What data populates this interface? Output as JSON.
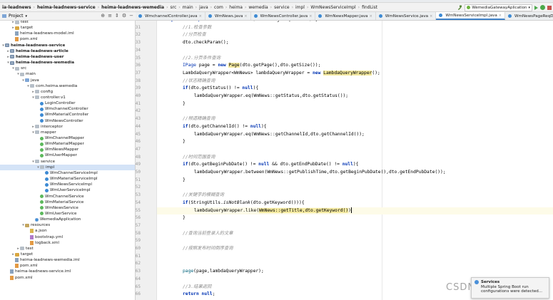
{
  "breadcrumbs": [
    "ia-leadnews",
    "heima-leadnews-service",
    "heima-leadnews-wemedia",
    "src",
    "main",
    "java",
    "com",
    "heima",
    "wemedia",
    "service",
    "impl",
    "WmNewsServiceImpl",
    "findList"
  ],
  "toolbar": {
    "run_config": "WemediaGatewayAplication"
  },
  "project": {
    "title": "Project"
  },
  "tree": [
    {
      "label": "test",
      "indent": 2,
      "icon": "folder",
      "arrow": ">"
    },
    {
      "label": "target",
      "indent": 2,
      "icon": "target",
      "arrow": ">"
    },
    {
      "label": "heima-leadnews-model.iml",
      "indent": 2,
      "icon": "iml",
      "arrow": ""
    },
    {
      "label": "pom.xml",
      "indent": 2,
      "icon": "xml",
      "arrow": ""
    },
    {
      "label": "heima-leadnews-service",
      "indent": 0,
      "icon": "mod",
      "arrow": "v",
      "bold": true
    },
    {
      "label": "heima-leadnews-article",
      "indent": 1,
      "icon": "mod",
      "arrow": ">",
      "bold": true
    },
    {
      "label": "heima-leadnews-user",
      "indent": 1,
      "icon": "mod",
      "arrow": ">",
      "bold": true
    },
    {
      "label": "heima-leadnews-wemedia",
      "indent": 1,
      "icon": "mod",
      "arrow": "v",
      "bold": true
    },
    {
      "label": "src",
      "indent": 2,
      "icon": "folder",
      "arrow": "v"
    },
    {
      "label": "main",
      "indent": 3,
      "icon": "folder",
      "arrow": "v"
    },
    {
      "label": "java",
      "indent": 4,
      "icon": "src",
      "arrow": "v"
    },
    {
      "label": "com.heima.wemedia",
      "indent": 5,
      "icon": "folder",
      "arrow": "v"
    },
    {
      "label": "config",
      "indent": 6,
      "icon": "folder",
      "arrow": ">"
    },
    {
      "label": "controller.v1",
      "indent": 6,
      "icon": "folder",
      "arrow": "v"
    },
    {
      "label": "LoginController",
      "indent": 7,
      "icon": "cls",
      "arrow": ""
    },
    {
      "label": "WmchannelController",
      "indent": 7,
      "icon": "cls",
      "arrow": ""
    },
    {
      "label": "WmMaterialController",
      "indent": 7,
      "icon": "cls",
      "arrow": ""
    },
    {
      "label": "WmNewsController",
      "indent": 7,
      "icon": "cls",
      "arrow": ""
    },
    {
      "label": "interceptor",
      "indent": 6,
      "icon": "folder",
      "arrow": ">"
    },
    {
      "label": "mapper",
      "indent": 6,
      "icon": "folder",
      "arrow": "v"
    },
    {
      "label": "WmChannelMapper",
      "indent": 7,
      "icon": "ifc",
      "arrow": ""
    },
    {
      "label": "WmMaterialMapper",
      "indent": 7,
      "icon": "ifc",
      "arrow": ""
    },
    {
      "label": "WmNewsMapper",
      "indent": 7,
      "icon": "ifc",
      "arrow": ""
    },
    {
      "label": "WmUserMapper",
      "indent": 7,
      "icon": "ifc",
      "arrow": ""
    },
    {
      "label": "service",
      "indent": 6,
      "icon": "folder",
      "arrow": "v"
    },
    {
      "label": "impl",
      "indent": 7,
      "icon": "folder",
      "arrow": "v",
      "selected": true
    },
    {
      "label": "WmChannelServiceImpl",
      "indent": 8,
      "icon": "cls",
      "arrow": ""
    },
    {
      "label": "WmMaterialServiceImpl",
      "indent": 8,
      "icon": "cls",
      "arrow": ""
    },
    {
      "label": "WmNewsServiceImpl",
      "indent": 8,
      "icon": "cls",
      "arrow": ""
    },
    {
      "label": "WmUserServiceImpl",
      "indent": 8,
      "icon": "cls",
      "arrow": ""
    },
    {
      "label": "WmChannelService",
      "indent": 7,
      "icon": "ifc",
      "arrow": ""
    },
    {
      "label": "WmMaterialService",
      "indent": 7,
      "icon": "ifc",
      "arrow": ""
    },
    {
      "label": "WmNewsService",
      "indent": 7,
      "icon": "ifc",
      "arrow": ""
    },
    {
      "label": "WmUserService",
      "indent": 7,
      "icon": "ifc",
      "arrow": ""
    },
    {
      "label": "WemediaApplication",
      "indent": 6,
      "icon": "app",
      "arrow": ""
    },
    {
      "label": "resources",
      "indent": 4,
      "icon": "res",
      "arrow": "v"
    },
    {
      "label": "a.json",
      "indent": 5,
      "icon": "json",
      "arrow": ""
    },
    {
      "label": "bootstrap.yml",
      "indent": 5,
      "icon": "yml",
      "arrow": ""
    },
    {
      "label": "logback.xml",
      "indent": 5,
      "icon": "xml",
      "arrow": ""
    },
    {
      "label": "test",
      "indent": 3,
      "icon": "folder",
      "arrow": ">"
    },
    {
      "label": "target",
      "indent": 2,
      "icon": "target",
      "arrow": ">"
    },
    {
      "label": "heima-leadnews-wemedia.iml",
      "indent": 2,
      "icon": "iml",
      "arrow": ""
    },
    {
      "label": "pom.xml",
      "indent": 2,
      "icon": "xml",
      "arrow": ""
    },
    {
      "label": "heima-leadnews-service.iml",
      "indent": 1,
      "icon": "iml",
      "arrow": ""
    },
    {
      "label": "pom.xml",
      "indent": 1,
      "icon": "xml",
      "arrow": ""
    }
  ],
  "tabs": [
    {
      "label": "WmchannelController.java",
      "active": false
    },
    {
      "label": "WmNews.java",
      "active": false
    },
    {
      "label": "WmNewsController.java",
      "active": false
    },
    {
      "label": "WmNewsMapper.java",
      "active": false
    },
    {
      "label": "WmNewsService.java",
      "active": false
    },
    {
      "label": "WmNewsServiceImpl.java",
      "active": true
    },
    {
      "label": "WmNewsPageReqDto.java",
      "active": false
    }
  ],
  "editor": {
    "lines": [
      {
        "n": "30",
        "html": "<span class='kw'>public</span> <span class='typ'>ResponseResult</span> <span class='meth'>findList</span>(WmNewsPageReqDto dto) {",
        "indent": 0
      },
      {
        "n": "31",
        "html": "<span class='cm'>//1.检查参数</span>",
        "indent": 1
      },
      {
        "n": "32",
        "html": "<span class='cm'>//分页检查</span>",
        "indent": 1
      },
      {
        "n": "33",
        "html": "dto.checkParam();",
        "indent": 1
      },
      {
        "n": "34",
        "html": "",
        "indent": 1
      },
      {
        "n": "35",
        "html": "<span class='cm'>//2.分页条件查询</span>",
        "indent": 1
      },
      {
        "n": "36",
        "html": "<span class='typ'>IPage</span> page = <span class='kw'>new</span> <span class='hlw'>Page</span>(dto.getPage(),dto.getSize());",
        "indent": 1
      },
      {
        "n": "37",
        "html": "LambdaQueryWrapper&lt;WmNews&gt; lambdaQueryWrapper = <span class='kw'>new</span> <span class='hlw'>LambdaQueryWrapper</span>();",
        "indent": 1
      },
      {
        "n": "38",
        "html": "<span class='cm'>//状态精确查询</span>",
        "indent": 1
      },
      {
        "n": "39",
        "html": "<span class='kw'>if</span>(dto.getStatus() != <span class='kw'>null</span>){",
        "indent": 1
      },
      {
        "n": "40",
        "html": "lambdaQueryWrapper.eq(WmNews::getStatus,dto.getStatus());",
        "indent": 2
      },
      {
        "n": "41",
        "html": "}",
        "indent": 1
      },
      {
        "n": "42",
        "html": "",
        "indent": 1
      },
      {
        "n": "43",
        "html": "<span class='cm'>//频道精确查询</span>",
        "indent": 1
      },
      {
        "n": "44",
        "html": "<span class='kw'>if</span>(dto.getChannelId() != <span class='kw'>null</span>){",
        "indent": 1
      },
      {
        "n": "45",
        "html": "lambdaQueryWrapper.eq(WmNews::getChannelId,dto.getChannelId());",
        "indent": 2
      },
      {
        "n": "46",
        "html": "}",
        "indent": 1
      },
      {
        "n": "47",
        "html": "",
        "indent": 1
      },
      {
        "n": "48",
        "html": "<span class='cm'>//时间范围查询</span>",
        "indent": 1
      },
      {
        "n": "49",
        "html": "<span class='kw'>if</span>(dto.getBeginPubDate() != <span class='kw'>null</span> &amp;&amp; dto.getEndPubDate() != <span class='kw'>null</span>){",
        "indent": 1
      },
      {
        "n": "50",
        "html": "lambdaQueryWrapper.between(WmNews::getPublishTime,dto.getBeginPubDate(),dto.getEndPubDate());",
        "indent": 2
      },
      {
        "n": "51",
        "html": "}",
        "indent": 1
      },
      {
        "n": "52",
        "html": "",
        "indent": 1
      },
      {
        "n": "53",
        "html": "<span class='cm'>//关键字的模糊查询</span>",
        "indent": 1
      },
      {
        "n": "54",
        "html": "<span class='kw'>if</span>(StringUtils.<i>isNotBlank</i>(dto.getKeyword())){",
        "indent": 1
      },
      {
        "n": "55",
        "html": "lambdaQueryWrapper.like(<span class='hlw'>WmNews::getTitle,dto.getKeyword()</span>)<span class='caret'></span>",
        "indent": 2,
        "current": true
      },
      {
        "n": "56",
        "html": "}",
        "indent": 1
      },
      {
        "n": "57",
        "html": "",
        "indent": 1
      },
      {
        "n": "58",
        "html": "<span class='cm'>//查询当前登录人的文章</span>",
        "indent": 1
      },
      {
        "n": "59",
        "html": "",
        "indent": 1
      },
      {
        "n": "60",
        "html": "<span class='cm'>//按照发布时间倒序查询</span>",
        "indent": 1
      },
      {
        "n": "61",
        "html": "",
        "indent": 1
      },
      {
        "n": "62",
        "html": "",
        "indent": 1
      },
      {
        "n": "63",
        "html": "<span class='meth'>page</span>(page,lambdaQueryWrapper);",
        "indent": 1
      },
      {
        "n": "64",
        "html": "",
        "indent": 1
      },
      {
        "n": "65",
        "html": "<span class='cm'>//3.结果返回</span>",
        "indent": 1
      },
      {
        "n": "66",
        "html": "<span class='kw'>return</span> <span class='kw'>null</span>;",
        "indent": 1
      }
    ]
  },
  "notification": {
    "title": "Services",
    "body": "Multiple Spring Boot run configurations were detected..."
  },
  "watermark": "CSDN @幸运小新"
}
